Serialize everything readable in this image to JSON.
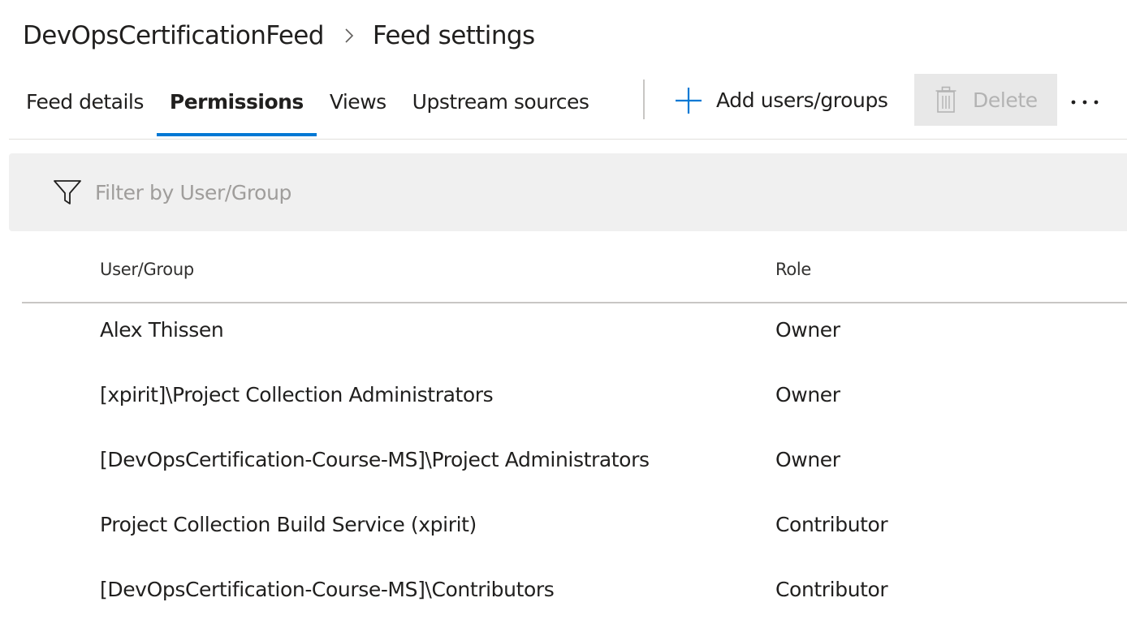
{
  "breadcrumb": {
    "feed_name": "DevOpsCertificationFeed",
    "page_title": "Feed settings",
    "separator_icon": "chevron-right-icon"
  },
  "tabs": [
    {
      "label": "Feed details",
      "active": false
    },
    {
      "label": "Permissions",
      "active": true
    },
    {
      "label": "Views",
      "active": false
    },
    {
      "label": "Upstream sources",
      "active": false
    }
  ],
  "commands": {
    "add_label": "Add users/groups",
    "add_icon": "plus-icon",
    "delete_label": "Delete",
    "delete_icon": "trash-icon",
    "delete_enabled": false,
    "more_icon": "more-options-icon"
  },
  "filter": {
    "placeholder": "Filter by User/Group",
    "value": "",
    "icon": "filter-icon"
  },
  "table": {
    "columns": [
      "User/Group",
      "Role"
    ],
    "rows": [
      {
        "user": "Alex Thissen",
        "role": "Owner"
      },
      {
        "user": "[xpirit]\\Project Collection Administrators",
        "role": "Owner"
      },
      {
        "user": "[DevOpsCertification-Course-MS]\\Project Administrators",
        "role": "Owner"
      },
      {
        "user": "Project Collection Build Service (xpirit)",
        "role": "Contributor"
      },
      {
        "user": "[DevOpsCertification-Course-MS]\\Contributors",
        "role": "Contributor"
      }
    ]
  },
  "colors": {
    "accent": "#0078d4",
    "disabled_text": "#b3b3b3",
    "filter_background": "#f0f0f0"
  }
}
